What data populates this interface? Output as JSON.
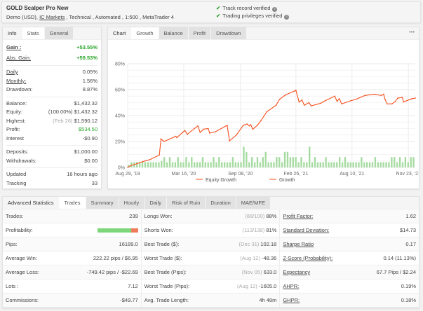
{
  "header": {
    "title": "GOLD Scalper Pro New",
    "subtitle_pre": "Demo (USD), ",
    "broker": "IC Markets",
    "subtitle_post": " , Technical , Automated , 1:500 , MetaTrader 4",
    "verified": [
      "Track record verified",
      "Trading privileges verified"
    ]
  },
  "left": {
    "tabs": [
      "Info",
      "Stats",
      "General"
    ],
    "gain": [
      {
        "label": "Gain :",
        "value": "+53.55%"
      },
      {
        "label": "Abs. Gain:",
        "value": "+59.53%"
      }
    ],
    "rates": [
      {
        "label": "Daily",
        "value": "0.05%"
      },
      {
        "label": "Monthly:",
        "value": "1.56%"
      },
      {
        "label": "Drawdown:",
        "value": "8.87%"
      }
    ],
    "balance": [
      {
        "label": "Balance:",
        "note": "",
        "value": "$1,432.32"
      },
      {
        "label": "Equity:",
        "note": "(100.00%)",
        "value": "$1,432.32"
      },
      {
        "label": "Highest:",
        "note": "(Feb 26)",
        "value": "$1,590.12"
      },
      {
        "label": "Profit:",
        "note": "",
        "value": "$534.50"
      },
      {
        "label": "Interest",
        "note": "",
        "value": "-$0.90"
      }
    ],
    "deposits": [
      {
        "label": "Deposits:",
        "value": "$1,000.00"
      },
      {
        "label": "Withdrawals:",
        "value": "$0.00"
      }
    ],
    "meta": [
      {
        "label": "Updated",
        "value": "16 hours ago"
      },
      {
        "label": "Tracking",
        "value": "33"
      }
    ]
  },
  "chart": {
    "tabs": [
      "Chart",
      "Growth",
      "Balance",
      "Profit",
      "Drawdown"
    ],
    "menu": "•••"
  },
  "chart_data": {
    "type": "line",
    "title": "Growth",
    "ylim": [
      0,
      80
    ],
    "yticks": [
      "0%",
      "20%",
      "40%",
      "60%",
      "80%"
    ],
    "ytick_values": [
      0,
      20,
      40,
      60,
      80
    ],
    "xticks": [
      {
        "label": "Aug 29, '19",
        "x": 0
      },
      {
        "label": "Mar 16, '20",
        "x": 19.5
      },
      {
        "label": "Sep 08, '20",
        "x": 39.2
      },
      {
        "label": "Feb 26, '21",
        "x": 58.5
      },
      {
        "label": "Aug 10, '21",
        "x": 78
      },
      {
        "label": "Nov 23, '21",
        "x": 97.6
      }
    ],
    "legend": [
      "Equity Growth",
      "Growth"
    ],
    "line_color": "#f4511e",
    "bar_color": "#a5dba0",
    "growth": [
      [
        0,
        0
      ],
      [
        1.2,
        1.5
      ],
      [
        2.4,
        2.3
      ],
      [
        5.3,
        4.5
      ],
      [
        7.7,
        6
      ],
      [
        11,
        9.5
      ],
      [
        11.6,
        22
      ],
      [
        12.6,
        20
      ],
      [
        14.2,
        21.5
      ],
      [
        16.7,
        24
      ],
      [
        17.1,
        23
      ],
      [
        19.1,
        27
      ],
      [
        19.9,
        28.5
      ],
      [
        20.7,
        25.5
      ],
      [
        23.2,
        30
      ],
      [
        24.4,
        32
      ],
      [
        25.2,
        27
      ],
      [
        26.4,
        29.5
      ],
      [
        28,
        30
      ],
      [
        28.5,
        26.5
      ],
      [
        30.5,
        27.5
      ],
      [
        34.6,
        32.5
      ],
      [
        35.4,
        20.5
      ],
      [
        37.8,
        25
      ],
      [
        40.2,
        32.5
      ],
      [
        41.5,
        33.5
      ],
      [
        42.3,
        32
      ],
      [
        42.8,
        33
      ],
      [
        43.5,
        29.5
      ],
      [
        45.1,
        32.5
      ],
      [
        46.3,
        36
      ],
      [
        48.4,
        43
      ],
      [
        51.6,
        48
      ],
      [
        52.8,
        52.5
      ],
      [
        54.9,
        56
      ],
      [
        58.1,
        59
      ],
      [
        58.5,
        59.5
      ],
      [
        59.6,
        50.5
      ],
      [
        60.6,
        52
      ],
      [
        61.4,
        48
      ],
      [
        63,
        50
      ],
      [
        63.8,
        47.5
      ],
      [
        67.1,
        49.5
      ],
      [
        68.7,
        51.5
      ],
      [
        72,
        55
      ],
      [
        72.8,
        51
      ],
      [
        73.6,
        53
      ],
      [
        74.4,
        49
      ],
      [
        77.6,
        51.5
      ],
      [
        79.3,
        52.5
      ],
      [
        82.5,
        55.5
      ],
      [
        85.8,
        56.5
      ],
      [
        88.2,
        55.5
      ],
      [
        89,
        56.5
      ],
      [
        89.4,
        53
      ],
      [
        90.2,
        49
      ],
      [
        91.9,
        49
      ],
      [
        93.1,
        51
      ],
      [
        93.9,
        53.5
      ],
      [
        95.5,
        54
      ],
      [
        95.9,
        50.5
      ],
      [
        98.8,
        53
      ],
      [
        100,
        53.5
      ]
    ],
    "bars": [
      2,
      4,
      4,
      4,
      4,
      4,
      4,
      4,
      4,
      4,
      4,
      4,
      5,
      8,
      4,
      8,
      4,
      4,
      8,
      4,
      4,
      8,
      4,
      8,
      4,
      4,
      4,
      8,
      4,
      4,
      4,
      8,
      4,
      8,
      4,
      4,
      4,
      4,
      8,
      4,
      4,
      4,
      16,
      12,
      4,
      8,
      4,
      8,
      4,
      8,
      12,
      4,
      4,
      4,
      8,
      8,
      4,
      12,
      12,
      8,
      8,
      8,
      4,
      8,
      4,
      4,
      16,
      4,
      8,
      4,
      4,
      4,
      8,
      4,
      4,
      4,
      4,
      8,
      4,
      8,
      4,
      4,
      4,
      4,
      4,
      8,
      4,
      4,
      4,
      4,
      8,
      4,
      4,
      4,
      4,
      4,
      8,
      8,
      4,
      8,
      4,
      8,
      4,
      8,
      8
    ]
  },
  "bottom": {
    "tabs": [
      "Advanced Statistics",
      "Trades",
      "Summary",
      "Hourly",
      "Daily",
      "Risk of Ruin",
      "Duration",
      "MAE/MFE"
    ],
    "col1": [
      {
        "label": "Trades:",
        "value": "239"
      },
      {
        "label": "Profitability:",
        "value": "",
        "bar": 0.84
      },
      {
        "label": "Pips:",
        "value": "16189.0"
      },
      {
        "label": "Average Win:",
        "value": "222.22 pips / $6.95"
      },
      {
        "label": "Average Loss:",
        "value": "-749.42 pips / -$22.69"
      },
      {
        "label": "Lots :",
        "value": "7.12"
      },
      {
        "label": "Commissions:",
        "value": "-$49.77"
      }
    ],
    "col2": [
      {
        "label": "Longs Won:",
        "note": "(88/100)",
        "value": "88%"
      },
      {
        "label": "Shorts Won:",
        "note": "(113/139)",
        "value": "81%"
      },
      {
        "label": "Best Trade ($):",
        "note": "(Dec 31)",
        "value": "102.18"
      },
      {
        "label": "Worst Trade ($):",
        "note": "(Aug 12)",
        "value": "-48.36"
      },
      {
        "label": "Best Trade (Pips):",
        "note": "(Nov 05)",
        "value": "633.0"
      },
      {
        "label": "Worst Trade (Pips):",
        "note": "(Aug 12)",
        "value": "-1605.0"
      },
      {
        "label": "Avg. Trade Length:",
        "note": "",
        "value": "4h 48m"
      }
    ],
    "col3": [
      {
        "label": "Profit Factor:",
        "value": "1.62"
      },
      {
        "label": "Standard Deviation:",
        "value": "$14.73"
      },
      {
        "label": "Sharpe Ratio",
        "value": "0.17"
      },
      {
        "label": "Z-Score (Probability):",
        "value": "0.14 (11.13%)"
      },
      {
        "label": "Expectancy",
        "value": "67.7 Pips / $2.24"
      },
      {
        "label": "AHPR:",
        "value": "0.19%"
      },
      {
        "label": "GHPR:",
        "value": "0.18%"
      }
    ]
  }
}
